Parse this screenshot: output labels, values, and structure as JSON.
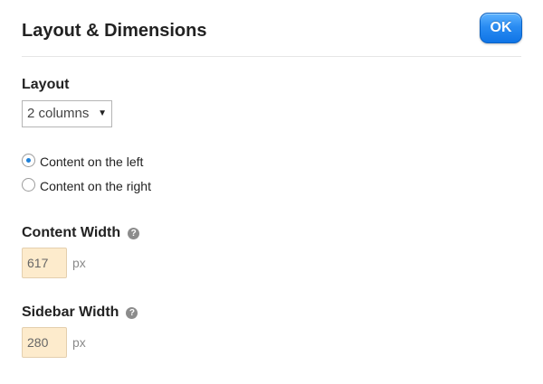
{
  "dialog": {
    "title": "Layout & Dimensions",
    "ok_label": "OK"
  },
  "layout": {
    "label": "Layout",
    "select_value": "2 columns",
    "options": [
      {
        "label": "Content on the left",
        "checked": true
      },
      {
        "label": "Content on the right",
        "checked": false
      }
    ]
  },
  "content_width": {
    "label": "Content Width",
    "value": "617",
    "unit": "px",
    "help_icon": "question-circle-icon"
  },
  "sidebar_width": {
    "label": "Sidebar Width",
    "value": "280",
    "unit": "px",
    "help_icon": "question-circle-icon"
  },
  "colors": {
    "accent": "#1e80d8",
    "ok_button": "#1a7fe9",
    "input_bg": "#fdebcc"
  }
}
